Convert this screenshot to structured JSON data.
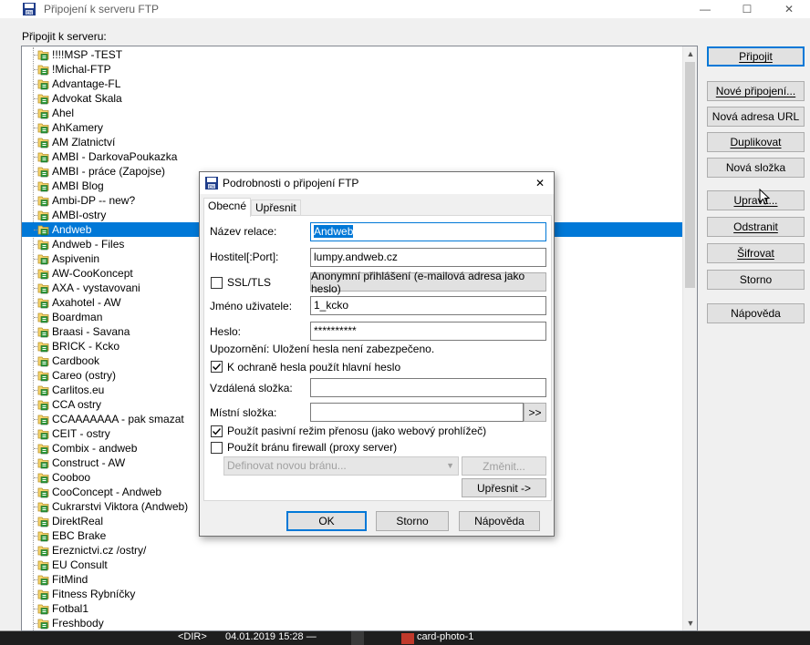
{
  "window": {
    "title": "Připojení k serveru FTP",
    "minimize_glyph": "—",
    "maximize_glyph": "☐",
    "close_glyph": "✕",
    "connect_label": "Připojit k serveru:"
  },
  "servers": [
    "!!!!MSP -TEST",
    "!Michal-FTP",
    "Advantage-FL",
    "Advokat Skala",
    "Ahel",
    "AhKamery",
    "AM Zlatnictví",
    "AMBI - DarkovaPoukazka",
    "AMBI - práce (Zapojse)",
    "AMBI Blog",
    "Ambi-DP -- new?",
    "AMBI-ostry",
    "Andweb",
    "Andweb - Files",
    "Aspivenin",
    "AW-CooKoncept",
    "AXA - vystavovani",
    "Axahotel - AW",
    "Boardman",
    "Braasi - Savana",
    "BRICK - Kcko",
    "Cardbook",
    "Careo (ostry)",
    "Carlitos.eu",
    "CCA ostry",
    "CCAAAAAAA - pak smazat",
    "CEIT - ostry",
    "Combix - andweb",
    "Construct - AW",
    "Cooboo",
    "CooConcept - Andweb",
    "Cukrarstvi Viktora (Andweb)",
    "DirektReal",
    "EBC Brake",
    "Ereznictvi.cz /ostry/",
    "EU Consult",
    "FitMind",
    "Fitness Rybníčky",
    "Fotbal1",
    "Freshbody"
  ],
  "selected_server": "Andweb",
  "buttons": {
    "connect": "Připojit",
    "new_connection": "Nové připojení...",
    "new_url": "Nová adresa URL",
    "duplicate": "Duplikovat",
    "new_folder": "Nová složka",
    "edit": "Upravit...",
    "delete": "Odstranit",
    "encrypt": "Šifrovat",
    "cancel": "Storno",
    "help": "Nápověda"
  },
  "status_strip": {
    "dir": "<DIR>",
    "date": "04.01.2019 15:28 —",
    "file": "card-photo-1"
  },
  "dialog": {
    "title": "Podrobnosti o připojení FTP",
    "tabs": [
      "Obecné",
      "Upřesnit"
    ],
    "active_tab": "Obecné",
    "session_name_label": "Název relace:",
    "session_name_value": "Andweb",
    "host_label": "Hostitel[:Port]:",
    "host_value": "lumpy.andweb.cz",
    "ssl_label": "SSL/TLS",
    "ssl_checked": false,
    "anonymous_button": "Anonymní přihlášení (e-mailová adresa jako heslo)",
    "username_label": "Jméno uživatele:",
    "username_value": "1_kcko",
    "password_label": "Heslo:",
    "password_value": "**********",
    "warning": "Upozornění: Uložení hesla není zabezpečeno.",
    "master_password_label": "K ochraně hesla použít hlavní heslo",
    "master_password_checked": true,
    "remote_folder_label": "Vzdálená složka:",
    "remote_folder_value": "",
    "local_folder_label": "Místní složka:",
    "local_folder_value": "",
    "browse_button": ">>",
    "passive_label": "Použít pasivní režim přenosu (jako webový prohlížeč)",
    "passive_checked": true,
    "firewall_label": "Použít bránu firewall (proxy server)",
    "firewall_checked": false,
    "gateway_placeholder": "Definovat novou bránu...",
    "change_button": "Změnit...",
    "advanced_button": "Upřesnit ->",
    "ok": "OK",
    "cancel": "Storno",
    "help": "Nápověda"
  }
}
